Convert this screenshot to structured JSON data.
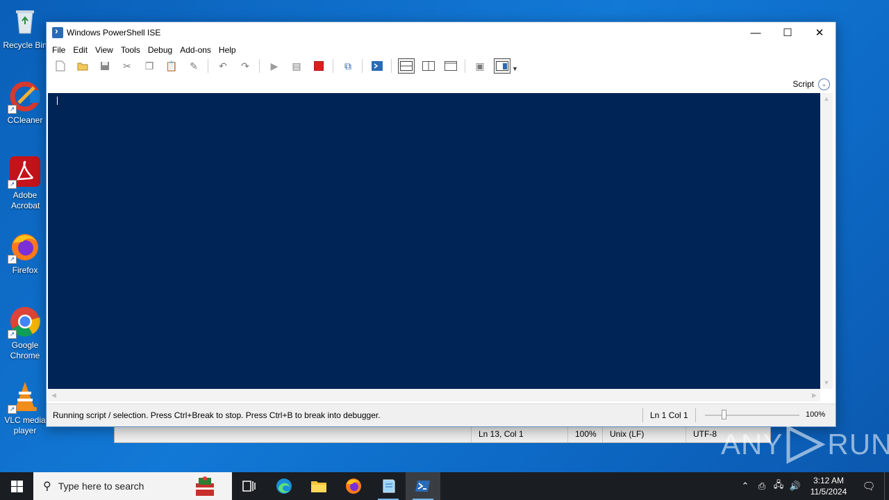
{
  "desktop": {
    "icons": [
      {
        "label": "Recycle Bin"
      },
      {
        "label": "CCleaner"
      },
      {
        "label": "Adobe Acrobat"
      },
      {
        "label": "Firefox"
      },
      {
        "label": "Google Chrome"
      },
      {
        "label": "VLC media player"
      }
    ]
  },
  "window": {
    "title": "Windows PowerShell ISE",
    "controls": {
      "minimize": "—",
      "maximize": "☐",
      "close": "✕"
    },
    "menu": [
      "File",
      "Edit",
      "View",
      "Tools",
      "Debug",
      "Add-ons",
      "Help"
    ],
    "toolbar_icons": [
      "new-icon",
      "open-icon",
      "save-icon",
      "cut-icon",
      "copy-icon",
      "paste-icon",
      "clear-icon",
      "undo-icon",
      "redo-icon",
      "run-icon",
      "run-selection-icon",
      "stop-icon",
      "remote-icon",
      "console-icon",
      "layout-top-icon",
      "layout-right-icon",
      "layout-max-icon",
      "show-commands-icon",
      "addon-icon"
    ],
    "script_pane": {
      "label": "Script"
    },
    "status": {
      "message": "Running script / selection.  Press Ctrl+Break to stop.  Press Ctrl+B to break into debugger.",
      "position": "Ln 1  Col 1",
      "zoom": "100%"
    },
    "zoom_fraction": 0.2
  },
  "background_window": {
    "status": [
      "Ln 13, Col 1",
      "100%",
      "Unix (LF)",
      "UTF-8"
    ]
  },
  "taskbar": {
    "search_placeholder": "Type here to search",
    "clock_time": "3:12 AM",
    "clock_date": "11/5/2024"
  },
  "watermark": {
    "text_left": "ANY",
    "text_right": "RUN"
  },
  "colors": {
    "editor_bg": "#012456",
    "taskbar_bg": "#1a1d22",
    "desktop": "#0d6ac6"
  }
}
